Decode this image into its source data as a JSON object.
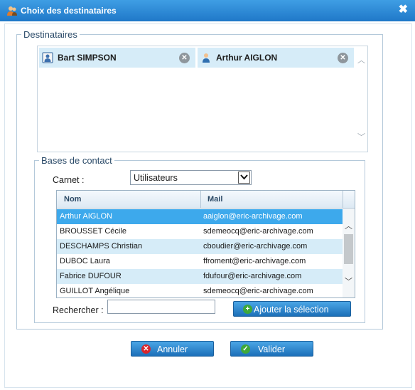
{
  "window": {
    "title": "Choix des destinataires",
    "close_glyph": "✖"
  },
  "recipients": {
    "legend": "Destinataires",
    "chips": [
      {
        "name": "Bart SIMPSON",
        "icon": "contact-card-icon"
      },
      {
        "name": "Arthur AIGLON",
        "icon": "user-icon"
      }
    ]
  },
  "contacts": {
    "legend": "Bases de contact",
    "carnet_label": "Carnet :",
    "carnet_value": "Utilisateurs",
    "columns": [
      "Nom",
      "Mail"
    ],
    "rows": [
      {
        "nom": "Arthur AIGLON",
        "mail": "aaiglon@eric-archivage.com",
        "selected": true
      },
      {
        "nom": "BROUSSET Cécile",
        "mail": "sdemeocq@eric-archivage.com"
      },
      {
        "nom": "DESCHAMPS Christian",
        "mail": "cboudier@eric-archivage.com"
      },
      {
        "nom": "DUBOC Laura",
        "mail": "ffroment@eric-archivage.com"
      },
      {
        "nom": "Fabrice DUFOUR",
        "mail": "fdufour@eric-archivage.com"
      },
      {
        "nom": "GUILLOT Angélique",
        "mail": "sdemeocq@eric-archivage.com"
      }
    ],
    "search_label": "Rechercher :",
    "search_value": "",
    "add_button": "Ajouter la sélection"
  },
  "footer": {
    "cancel": "Annuler",
    "validate": "Valider"
  },
  "colors": {
    "titlebar": "#2a8ad6",
    "selected_row": "#3da9ec",
    "alt_row": "#d6ecf8",
    "button": "#2d88d2",
    "cancel_icon": "#d8262c",
    "validate_icon": "#3ea83a"
  }
}
